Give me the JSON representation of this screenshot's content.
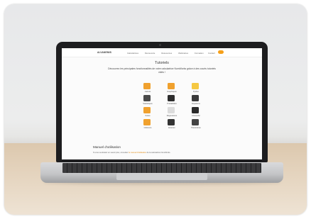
{
  "screen": {
    "logo": "ALVANEMIS",
    "nav": [
      "Calculatrices",
      "Découverte",
      "Ressources",
      "Webinaires",
      "Formation"
    ],
    "contact": "Contact",
    "title": "Tutoriels",
    "subtitle": "Découvrez les principales fonctionnalités de votre calculatrice NumWorks grâce à des courts tutoriels vidéo !",
    "tiles": [
      {
        "label": "Calculs",
        "color": "#f0a12e",
        "icon": "calculator-icon"
      },
      {
        "label": "Graphiques",
        "color": "#f0a12e",
        "icon": "graph-icon"
      },
      {
        "label": "Python",
        "color": "#f5c842",
        "icon": "python-icon"
      },
      {
        "label": "Statistiques",
        "color": "#4a4a4a",
        "icon": "statistics-icon"
      },
      {
        "label": "Probabilités",
        "color": "#2d2d2d",
        "icon": "probability-icon"
      },
      {
        "label": "Equations",
        "color": "#3a3a3a",
        "icon": "equation-icon"
      },
      {
        "label": "Suites",
        "color": "#f0a12e",
        "icon": "sequence-icon"
      },
      {
        "label": "Régressions",
        "color": "#dcdcdc",
        "icon": "regression-icon"
      },
      {
        "label": "Chimie/Sc",
        "color": "#2a2a2a",
        "icon": "elements-icon"
      },
      {
        "label": "Inférence",
        "color": "#f0a12e",
        "icon": "inference-icon"
      },
      {
        "label": "Examen",
        "color": "#333333",
        "icon": "exam-icon"
      },
      {
        "label": "Paramètres",
        "color": "#444444",
        "icon": "settings-icon"
      }
    ],
    "manual_title": "Manuel d'utilisation",
    "manual_desc": "Si vous souhaitez en savoir plus, consultez",
    "manual_link": "le manuel d'utilisation",
    "manual_desc_end": "de la calculatrice NumWorks."
  },
  "laptop": {
    "brand": "MacBook Air"
  }
}
